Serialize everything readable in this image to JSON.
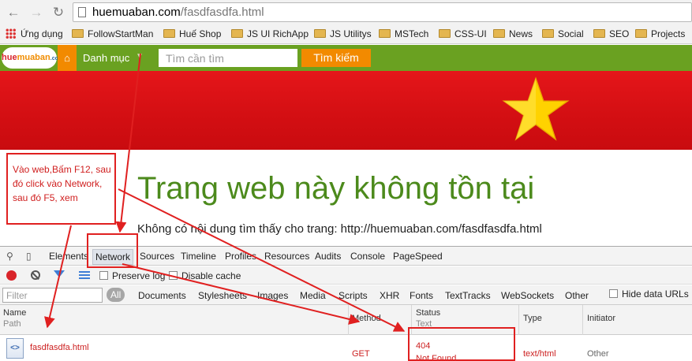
{
  "browser": {
    "url_host": "huemuaban.com",
    "url_path": "/fasdfasdfa.html",
    "bookmarks": [
      {
        "label": "Ứng dụng",
        "icon": "apps-icon"
      },
      {
        "label": "FollowStartMan",
        "icon": "folder-icon"
      },
      {
        "label": "Huế Shop",
        "icon": "folder-icon"
      },
      {
        "label": "JS UI RichApp",
        "icon": "folder-icon"
      },
      {
        "label": "JS Utilitys",
        "icon": "folder-icon"
      },
      {
        "label": "MSTech",
        "icon": "folder-icon"
      },
      {
        "label": "CSS-UI",
        "icon": "folder-icon"
      },
      {
        "label": "News",
        "icon": "folder-icon"
      },
      {
        "label": "Social",
        "icon": "folder-icon"
      },
      {
        "label": "SEO",
        "icon": "folder-icon"
      },
      {
        "label": "Projects",
        "icon": "folder-icon"
      }
    ]
  },
  "site": {
    "logo_part1": "hue",
    "logo_part2": "muaban",
    "logo_part3": ".com",
    "menu_label": "Danh mục",
    "search_placeholder": "Tìm cần tìm",
    "search_button": "Tìm kiếm",
    "title": "Trang web này không tồn tại",
    "message": "Không có nội dung tìm thấy cho trang: http://huemuaban.com/fasdfasdfa.html",
    "banner_color": "#d40f13",
    "star_color": "#ffd200"
  },
  "devtools": {
    "tabs": [
      "Elements",
      "Network",
      "Sources",
      "Timeline",
      "Profiles",
      "Resources",
      "Audits",
      "Console",
      "PageSpeed"
    ],
    "active_tab": "Network",
    "preserve_log": "Preserve log",
    "disable_cache": "Disable cache",
    "filter_placeholder": "Filter",
    "filter_types": [
      "All",
      "Documents",
      "Stylesheets",
      "Images",
      "Media",
      "Scripts",
      "XHR",
      "Fonts",
      "TextTracks",
      "WebSockets",
      "Other"
    ],
    "hide_data_urls": "Hide data URLs",
    "columns": {
      "name": "Name",
      "path": "Path",
      "method": "Method",
      "status": "Status",
      "text": "Text",
      "type": "Type",
      "initiator": "Initiator"
    },
    "row": {
      "name": "fasdfasdfa.html",
      "method": "GET",
      "status_code": "404",
      "status_text": "Not Found",
      "type": "text/html",
      "initiator": "Other"
    }
  },
  "annotation": {
    "note": "Vào web,Bấm F12, sau đó click vào Network, sau đó F5, xem",
    "color": "#e02020"
  }
}
